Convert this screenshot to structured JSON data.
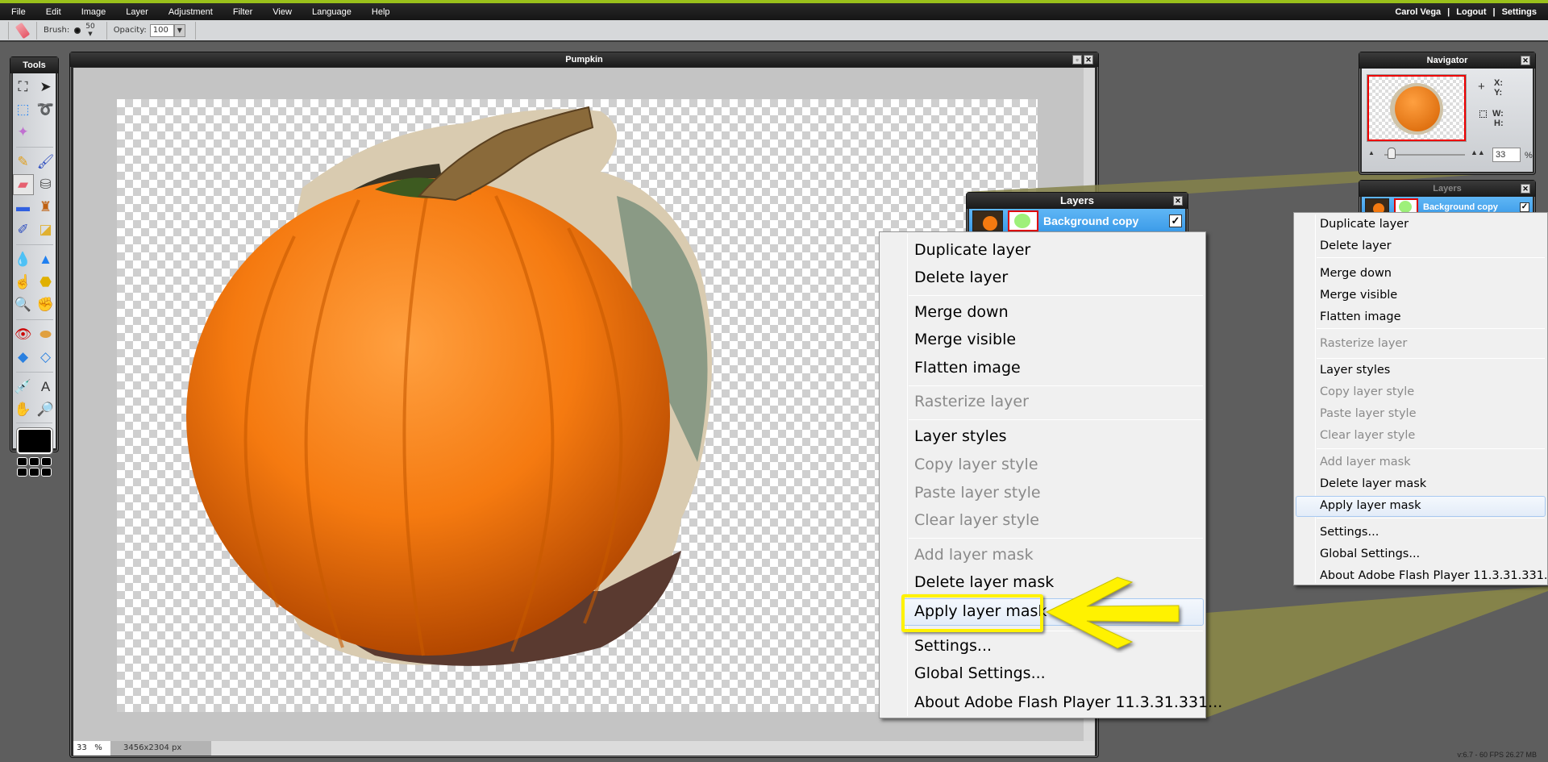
{
  "menubar": {
    "items": [
      "File",
      "Edit",
      "Image",
      "Layer",
      "Adjustment",
      "Filter",
      "View",
      "Language",
      "Help"
    ],
    "user": "Carol Vega",
    "sep": "|",
    "logout": "Logout",
    "settings": "Settings"
  },
  "toolbar": {
    "tool_icon": "eraser-icon",
    "brush_label": "Brush:",
    "brush_size": "50",
    "opacity_label": "Opacity:",
    "opacity_value": "100",
    "dropdown_arrow": "▼"
  },
  "tools": {
    "title": "Tools",
    "items": [
      [
        "crop-icon",
        "⛶"
      ],
      [
        "move-icon",
        "➤"
      ],
      [
        "marquee-icon",
        "⬚"
      ],
      [
        "lasso-icon",
        "➰"
      ],
      [
        "magic-wand-icon",
        "✦"
      ],
      null,
      [
        "pencil-icon",
        "✎"
      ],
      [
        "brush-icon",
        "🖌"
      ],
      [
        "eraser-icon",
        "▰"
      ],
      [
        "paint-bucket-icon",
        "⛁"
      ],
      [
        "gradient-icon",
        "▬"
      ],
      [
        "clone-stamp-icon",
        "♜"
      ],
      [
        "color-replace-icon",
        "✐"
      ],
      [
        "shapes-icon",
        "◪"
      ],
      [
        "blur-icon",
        "💧"
      ],
      [
        "sharpen-icon",
        "▲"
      ],
      [
        "smudge-icon",
        "☝"
      ],
      [
        "sponge-icon",
        "⬣"
      ],
      [
        "burn-icon",
        "🔍"
      ],
      [
        "dodge-icon",
        "✊"
      ],
      [
        "red-eye-icon",
        "👁"
      ],
      [
        "spot-heal-icon",
        "⬬"
      ],
      [
        "bloat-icon",
        "◆"
      ],
      [
        "pinch-icon",
        "◇"
      ],
      [
        "color-picker-icon",
        "💉"
      ],
      [
        "type-icon",
        "A"
      ],
      [
        "hand-icon",
        "✋"
      ],
      [
        "zoom-icon",
        "🔎"
      ]
    ],
    "selected": "eraser-icon"
  },
  "colors": {
    "accent_green": "#9ac11b",
    "primary_color": "#000000",
    "menu_highlight": "#e3ecf8",
    "annotation_yellow": "#fff200",
    "callout_olive": "#85834a",
    "layer_selected": "#3a9ae8"
  },
  "document": {
    "title": "Pumpkin",
    "zoom": "33",
    "zoom_unit": "%",
    "dimensions": "3456x2304 px"
  },
  "layers_panel": {
    "title": "Layers",
    "layer_name": "Background copy",
    "visible": "✓"
  },
  "context_menu": {
    "items": [
      {
        "label": "Duplicate layer",
        "enabled": true
      },
      {
        "label": "Delete layer",
        "enabled": true
      },
      {
        "label": "Merge down",
        "enabled": true
      },
      {
        "label": "Merge visible",
        "enabled": true
      },
      {
        "label": "Flatten image",
        "enabled": true
      },
      {
        "label": "Rasterize layer",
        "enabled": false
      },
      {
        "label": "Layer styles",
        "enabled": true
      },
      {
        "label": "Copy layer style",
        "enabled": false
      },
      {
        "label": "Paste layer style",
        "enabled": false
      },
      {
        "label": "Clear layer style",
        "enabled": false
      },
      {
        "label": "Add layer mask",
        "enabled": false
      },
      {
        "label": "Delete layer mask",
        "enabled": true
      },
      {
        "label": "Apply layer mask",
        "enabled": true,
        "highlighted": true
      },
      {
        "label": "Settings...",
        "enabled": true
      },
      {
        "label": "Global Settings...",
        "enabled": true
      },
      {
        "label": "About Adobe Flash Player 11.3.31.331...",
        "enabled": true
      }
    ]
  },
  "navigator": {
    "title": "Navigator",
    "x_label": "X:",
    "y_label": "Y:",
    "w_label": "W:",
    "h_label": "H:",
    "zoom": "33",
    "zoom_unit": "%"
  },
  "footer": {
    "version": "v:6.7 - 60 FPS 26.27 MB"
  }
}
